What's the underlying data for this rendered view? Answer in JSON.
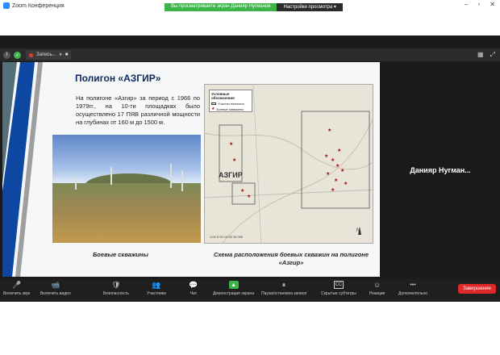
{
  "window": {
    "title": "Zoom Конференция"
  },
  "share_banner": {
    "viewing": "Вы просматриваете экран Данияр Нугманов",
    "options": "Настройки просмотра ▾"
  },
  "recording": {
    "label": "Запись..."
  },
  "slide": {
    "title": "Полигон «АЗГИР»",
    "body": "На полигоне «Азгир» за период с 1966 по 1979гг., на 10-ти площадках было осуществлено 17 ПЯВ различной мощности на глубинах от 160 м до 1500 м.",
    "caption_photo": "Боевые скважины",
    "caption_map": "Схема расположения боевых скважин на полигоне «Азгир»",
    "map": {
      "legend_title": "Условные обозначения",
      "legend_area": "Участки полигона",
      "legend_wells": "Боевые скважины",
      "place_label": "АЗГИР",
      "scale": "1:00   5 00   10 00   15 000"
    }
  },
  "participant": {
    "name": "Данияр Нугман..."
  },
  "toolbar": {
    "items": [
      {
        "label": "Включить звук",
        "icon": "🎤"
      },
      {
        "label": "Включить видео",
        "icon": "📹"
      },
      {
        "label": "Безопасность",
        "icon": "🛡"
      },
      {
        "label": "Участники",
        "icon": "👥"
      },
      {
        "label": "Чат",
        "icon": "💬"
      },
      {
        "label": "Демонстрация экрана",
        "icon": "▲"
      },
      {
        "label": "Пауза/остановка записи",
        "icon": "⏸"
      },
      {
        "label": "Скрытые субтитры",
        "icon": "CC"
      },
      {
        "label": "Реакции",
        "icon": "☺"
      },
      {
        "label": "Дополнительно",
        "icon": "•••"
      }
    ],
    "end_label": "Завершение"
  }
}
